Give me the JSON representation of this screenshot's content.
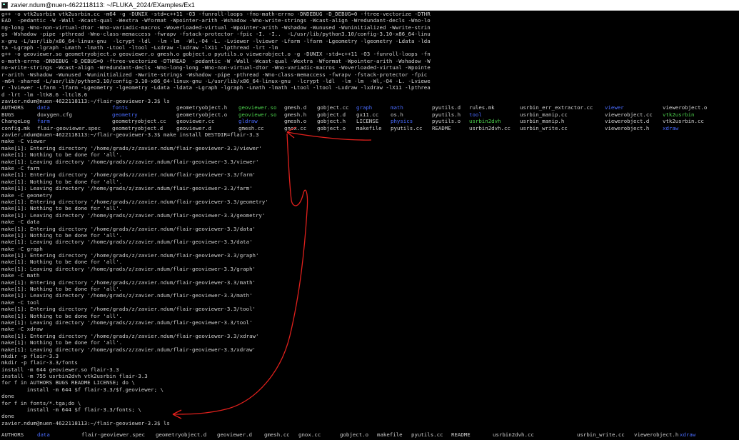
{
  "window": {
    "title": "zavier.ndum@nuen-4622118113: ~/FLUKA_2024/EXamples/Ex1",
    "icon": "terminal-icon"
  },
  "colors": {
    "directory": "#4a6cff",
    "executable": "#4cd04c",
    "text": "#cfcfcf",
    "background": "#000000",
    "annotation": "#e0201c"
  },
  "output_top": [
    "g++ -o vtk2usrbin vtk2usrbin.cc -m64 -g -DUNIX -std=c++11 -O3 -funroll-loops -fno-math-errno -DNDEBUG -D_DEBUG=0 -ftree-vectorize -DTHR",
    "EAD  -pedantic -W -Wall -Wcast-qual -Wextra -Wformat -Wpointer-arith -Wshadow -Wno-write-strings -Wcast-align -Wredundant-decls -Wno-lo",
    "ng-long -Wno-non-virtual-dtor -Wno-variadic-macros -Woverloaded-virtual -Wpointer-arith -Wshadow -Wunused -Wuninitialized -Wwrite-strin",
    "gs -Wshadow -pipe -pthread -Wno-class-memaccess -fwrapv -fstack-protector -fpic -I. -I..  -L/usr/lib/python3.10/config-3.10-x86_64-linu",
    "x-gnu -L/usr/lib/x86_64-linux-gnu  -lcrypt -ldl  -lm -lm  -Wl,-O4 -L. -Lviewer -lviewer -Lfarm -lfarm -Lgeometry -lgeometry -Ldata -lda",
    "ta -Lgraph -lgraph -Lmath -lmath -Ltool -ltool -Lxdraw -lxdraw -lX11 -lpthread -lrt -lm",
    "g++ -o geoviewer.so geometryobject.o geoviewer.o gmesh.o gobject.o pyutils.o viewerobject.o -g -DUNIX -std=c++11 -O3 -funroll-loops -fn",
    "o-math-errno -DNDEBUG -D_DEBUG=0 -ftree-vectorize -DTHREAD  -pedantic -W -Wall -Wcast-qual -Wextra -Wformat -Wpointer-arith -Wshadow -W",
    "no-write-strings -Wcast-align -Wredundant-decls -Wno-long-long -Wno-non-virtual-dtor -Wno-variadic-macros -Woverloaded-virtual -Wpointe",
    "r-arith -Wshadow -Wunused -Wuninitialized -Wwrite-strings -Wshadow -pipe -pthread -Wno-class-memaccess -fwrapv -fstack-protector -fpic",
    "-m64 -shared -L/usr/lib/python3.10/config-3.10-x86_64-linux-gnu -L/usr/lib/x86_64-linux-gnu  -lcrypt -ldl  -lm -lm  -Wl,-O4 -L. -Lviewe",
    "r -lviewer -Lfarm -lfarm -Lgeometry -lgeometry -Ldata -ldata -Lgraph -lgraph -Lmath -lmath -Ltool -ltool -Lxdraw -lxdraw -lX11 -lpthrea",
    "d -lrt -lm -ltk8.6 -ltcl8.6",
    "zavier.ndum@nuen-4622118113:~/flair-geoviewer-3.3$ ls"
  ],
  "ls1": [
    [
      {
        "t": "AUTHORS",
        "c": "reg"
      },
      {
        "t": "data",
        "c": "dir"
      },
      {
        "t": "fonts",
        "c": "dir"
      },
      {
        "t": "geometryobject.h",
        "c": "reg"
      },
      {
        "t": "geoviewer.so",
        "c": "exe"
      },
      {
        "t": "gmesh.d",
        "c": "reg"
      },
      {
        "t": "gobject.cc",
        "c": "reg"
      },
      {
        "t": "graph",
        "c": "dir"
      },
      {
        "t": "math",
        "c": "dir"
      },
      {
        "t": "pyutils.d",
        "c": "reg"
      },
      {
        "t": "rules.mk",
        "c": "reg"
      },
      {
        "t": "usrbin_err_extractor.cc",
        "c": "reg"
      },
      {
        "t": "viewer",
        "c": "dir"
      },
      {
        "t": "viewerobject.o",
        "c": "reg"
      }
    ],
    [
      {
        "t": "BUGS",
        "c": "reg"
      },
      {
        "t": "doxygen.cfg",
        "c": "reg"
      },
      {
        "t": "geometry",
        "c": "dir"
      },
      {
        "t": "geometryobject.o",
        "c": "reg"
      },
      {
        "t": "geoviewer.so",
        "c": "exe"
      },
      {
        "t": "gmesh.h",
        "c": "reg"
      },
      {
        "t": "gobject.d",
        "c": "reg"
      },
      {
        "t": "gx11.cc",
        "c": "reg"
      },
      {
        "t": "os.h",
        "c": "reg"
      },
      {
        "t": "pyutils.h",
        "c": "reg"
      },
      {
        "t": "tool",
        "c": "dir"
      },
      {
        "t": "usrbin_manip.cc",
        "c": "reg"
      },
      {
        "t": "viewerobject.cc",
        "c": "reg"
      },
      {
        "t": "vtk2usrbin",
        "c": "exe"
      }
    ],
    [
      {
        "t": "ChangeLog",
        "c": "reg"
      },
      {
        "t": "farm",
        "c": "dir"
      },
      {
        "t": "geometryobject.cc",
        "c": "reg"
      },
      {
        "t": "geoviewer.cc",
        "c": "reg"
      },
      {
        "t": "gldraw",
        "c": "dir"
      },
      {
        "t": "gmesh.o",
        "c": "reg"
      },
      {
        "t": "gobject.h",
        "c": "reg"
      },
      {
        "t": "LICENSE",
        "c": "reg"
      },
      {
        "t": "physics",
        "c": "dir"
      },
      {
        "t": "pyutils.o",
        "c": "reg"
      },
      {
        "t": "usrbin2dvh",
        "c": "exe"
      },
      {
        "t": "usrbin_manip.h",
        "c": "reg"
      },
      {
        "t": "viewerobject.d",
        "c": "reg"
      },
      {
        "t": "vtk2usrbin.cc",
        "c": "reg"
      }
    ],
    [
      {
        "t": "config.mk",
        "c": "reg"
      },
      {
        "t": "flair-geoviewer.spec",
        "c": "reg"
      },
      {
        "t": "geometryobject.d",
        "c": "reg"
      },
      {
        "t": "geoviewer.d",
        "c": "reg"
      },
      {
        "t": "gmesh.cc",
        "c": "reg"
      },
      {
        "t": "gnox.cc",
        "c": "reg"
      },
      {
        "t": "gobject.o",
        "c": "reg"
      },
      {
        "t": "makefile",
        "c": "reg"
      },
      {
        "t": "pyutils.cc",
        "c": "reg"
      },
      {
        "t": "README",
        "c": "reg"
      },
      {
        "t": "usrbin2dvh.cc",
        "c": "reg"
      },
      {
        "t": "usrbin_write.cc",
        "c": "reg"
      },
      {
        "t": "viewerobject.h",
        "c": "reg"
      },
      {
        "t": "xdraw",
        "c": "dir"
      }
    ]
  ],
  "output_bottom": [
    "zavier.ndum@nuen-4622118113:~/flair-geoviewer-3.3$ make install DESTDIR=flair-3.3",
    "make -C viewer",
    "make[1]: Entering directory '/home/grads/z/zavier.ndum/flair-geoviewer-3.3/viewer'",
    "make[1]: Nothing to be done for 'all'.",
    "make[1]: Leaving directory '/home/grads/z/zavier.ndum/flair-geoviewer-3.3/viewer'",
    "make -C farm",
    "make[1]: Entering directory '/home/grads/z/zavier.ndum/flair-geoviewer-3.3/farm'",
    "make[1]: Nothing to be done for 'all'.",
    "make[1]: Leaving directory '/home/grads/z/zavier.ndum/flair-geoviewer-3.3/farm'",
    "make -C geometry",
    "make[1]: Entering directory '/home/grads/z/zavier.ndum/flair-geoviewer-3.3/geometry'",
    "make[1]: Nothing to be done for 'all'.",
    "make[1]: Leaving directory '/home/grads/z/zavier.ndum/flair-geoviewer-3.3/geometry'",
    "make -C data",
    "make[1]: Entering directory '/home/grads/z/zavier.ndum/flair-geoviewer-3.3/data'",
    "make[1]: Nothing to be done for 'all'.",
    "make[1]: Leaving directory '/home/grads/z/zavier.ndum/flair-geoviewer-3.3/data'",
    "make -C graph",
    "make[1]: Entering directory '/home/grads/z/zavier.ndum/flair-geoviewer-3.3/graph'",
    "make[1]: Nothing to be done for 'all'.",
    "make[1]: Leaving directory '/home/grads/z/zavier.ndum/flair-geoviewer-3.3/graph'",
    "make -C math",
    "make[1]: Entering directory '/home/grads/z/zavier.ndum/flair-geoviewer-3.3/math'",
    "make[1]: Nothing to be done for 'all'.",
    "make[1]: Leaving directory '/home/grads/z/zavier.ndum/flair-geoviewer-3.3/math'",
    "make -C tool",
    "make[1]: Entering directory '/home/grads/z/zavier.ndum/flair-geoviewer-3.3/tool'",
    "make[1]: Nothing to be done for 'all'.",
    "make[1]: Leaving directory '/home/grads/z/zavier.ndum/flair-geoviewer-3.3/tool'",
    "make -C xdraw",
    "make[1]: Entering directory '/home/grads/z/zavier.ndum/flair-geoviewer-3.3/xdraw'",
    "make[1]: Nothing to be done for 'all'.",
    "make[1]: Leaving directory '/home/grads/z/zavier.ndum/flair-geoviewer-3.3/xdraw'",
    "mkdir -p flair-3.3",
    "mkdir -p flair-3.3/fonts",
    "install -m 644 geoviewer.so flair-3.3",
    "install -m 755 usrbin2dvh vtk2usrbin flair-3.3",
    "for f in AUTHORS BUGS README LICENSE; do \\",
    "        install -m 644 $f flair-3.3/$f.geoviewer; \\",
    "done",
    "for f in fonts/*.tga;do \\",
    "        install -m 644 $f flair-3.3/fonts; \\",
    "done",
    "zavier.ndum@nuen-4622118113:~/flair-geoviewer-3.3$ ls"
  ],
  "ls2": [
    {
      "t": "AUTHORS",
      "c": "reg"
    },
    {
      "t": "data",
      "c": "dir"
    },
    {
      "t": "flair-geoviewer.spec",
      "c": "reg"
    },
    {
      "t": "geometryobject.d",
      "c": "reg"
    },
    {
      "t": "geoviewer.d",
      "c": "reg"
    },
    {
      "t": "gmesh.cc",
      "c": "reg"
    },
    {
      "t": "gnox.cc",
      "c": "reg"
    },
    {
      "t": "gobject.o",
      "c": "reg"
    },
    {
      "t": "makefile",
      "c": "reg"
    },
    {
      "t": "pyutils.cc",
      "c": "reg"
    },
    {
      "t": "README",
      "c": "reg"
    },
    {
      "t": "usrbin2dvh.cc",
      "c": "reg"
    },
    {
      "t": "usrbin_write.cc",
      "c": "reg"
    },
    {
      "t": "viewerobject.h",
      "c": "reg"
    },
    {
      "t": "xdraw",
      "c": "dir"
    }
  ]
}
